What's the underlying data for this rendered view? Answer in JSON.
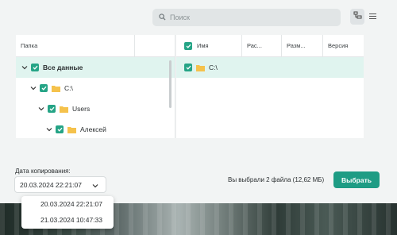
{
  "search": {
    "placeholder": "Поиск",
    "icon": "search-icon"
  },
  "view_toggle": {
    "tree_icon": "tree-view-icon",
    "list_icon": "list-view-icon"
  },
  "tree": {
    "header": "Папка",
    "items": [
      {
        "label": "Все данные"
      },
      {
        "label": "C:\\"
      },
      {
        "label": "Users"
      },
      {
        "label": "Алексей"
      }
    ]
  },
  "files": {
    "columns": [
      "Имя",
      "Рас...",
      "Разм...",
      "Версия"
    ],
    "rows": [
      {
        "name": "C:\\"
      }
    ]
  },
  "backup": {
    "date_label": "Дата копирования:",
    "selected": "20.03.2024 22:21:07",
    "options": [
      "20.03.2024 22:21:07",
      "21.03.2024 10:47:33"
    ]
  },
  "summary": "Вы выбрали 2 файла (12,62 МБ)",
  "choose_label": "Выбрать",
  "colors": {
    "accent": "#1e9c84",
    "selected_row": "#e0f4ef"
  }
}
